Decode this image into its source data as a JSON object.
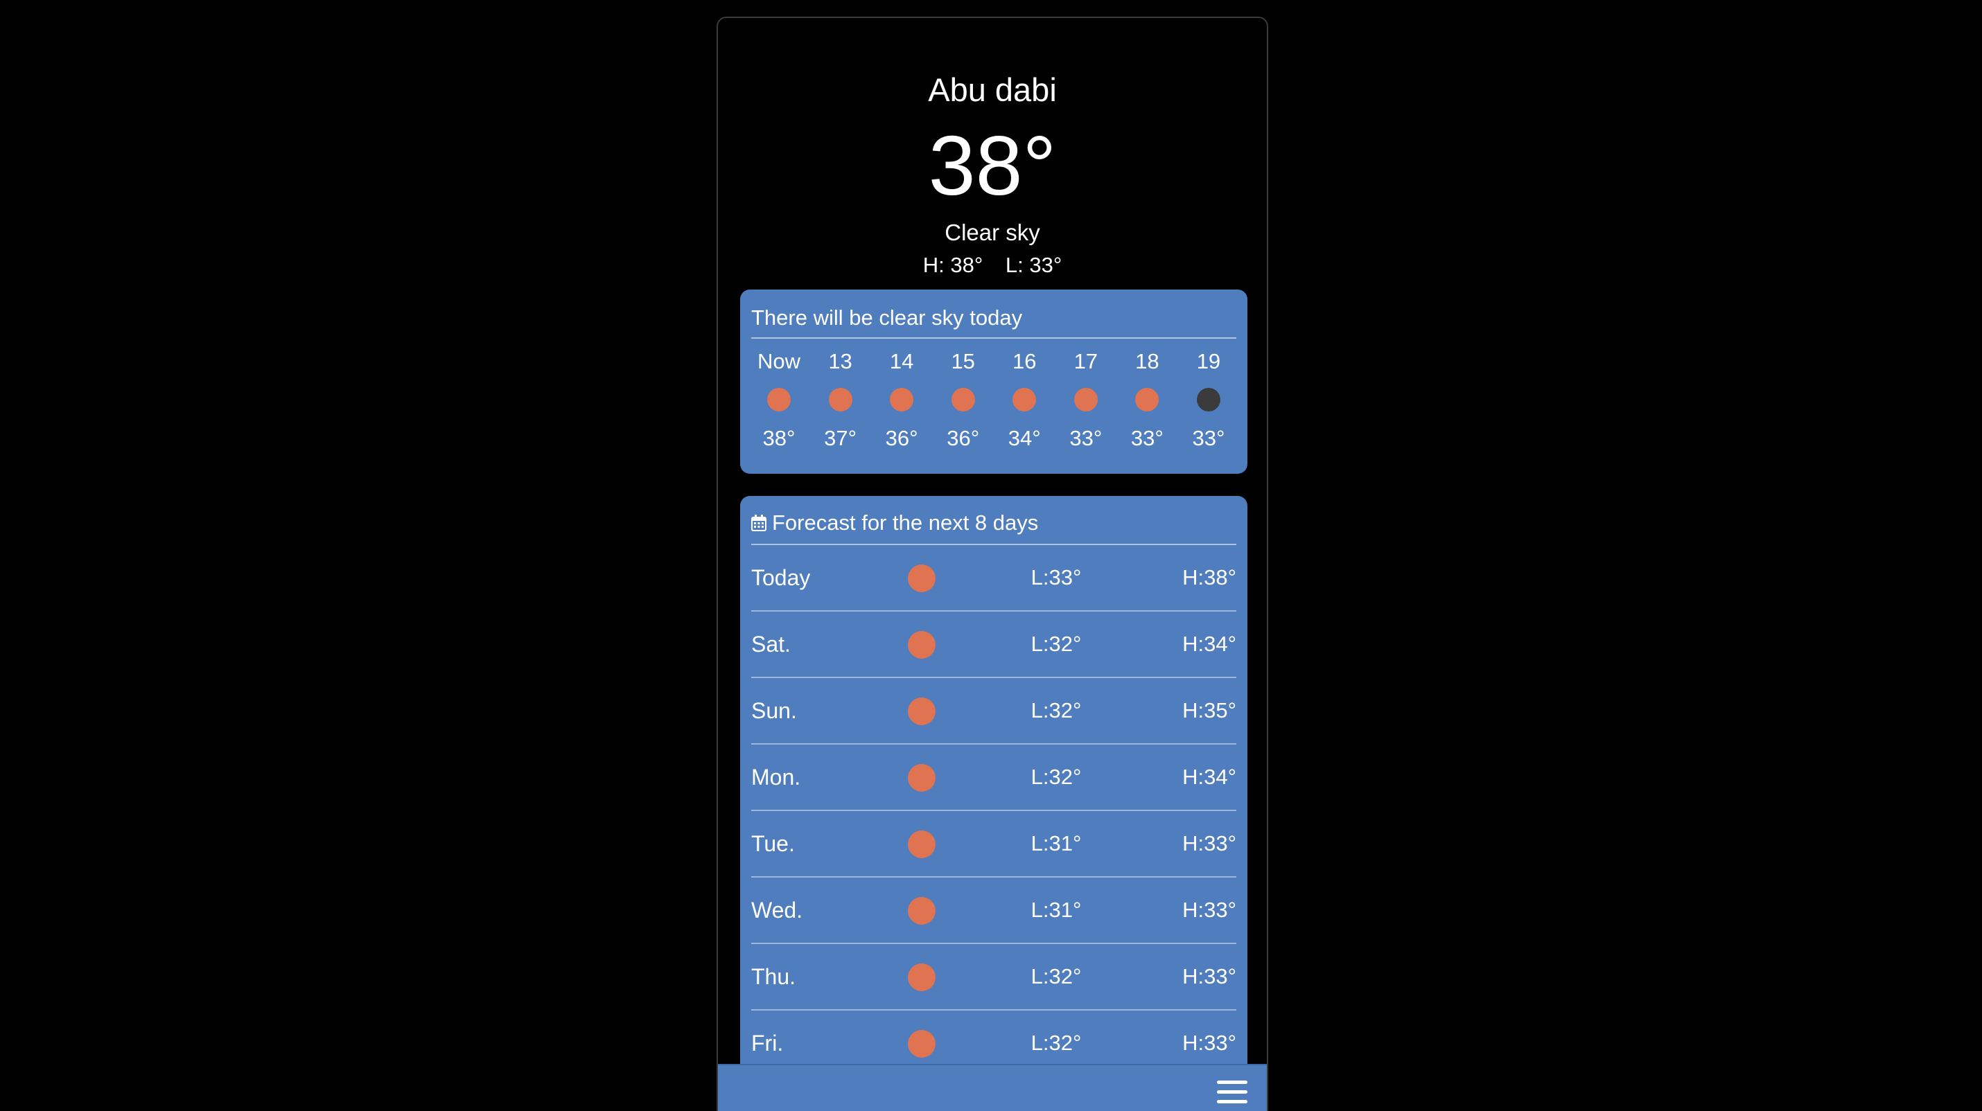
{
  "current": {
    "city": "Abu dabi",
    "temperature": "38°",
    "condition": "Clear sky",
    "high": "H: 38°",
    "low": "L: 33°"
  },
  "hourly": {
    "title": "There will be clear sky today",
    "items": [
      {
        "time": "Now",
        "temp": "38°",
        "icon": "sun-icon"
      },
      {
        "time": "13",
        "temp": "37°",
        "icon": "sun-icon"
      },
      {
        "time": "14",
        "temp": "36°",
        "icon": "sun-icon"
      },
      {
        "time": "15",
        "temp": "36°",
        "icon": "sun-icon"
      },
      {
        "time": "16",
        "temp": "34°",
        "icon": "sun-icon"
      },
      {
        "time": "17",
        "temp": "33°",
        "icon": "sun-icon"
      },
      {
        "time": "18",
        "temp": "33°",
        "icon": "sun-icon"
      },
      {
        "time": "19",
        "temp": "33°",
        "icon": "moon-icon"
      }
    ]
  },
  "daily": {
    "title": "Forecast for the next 8 days",
    "title_icon": "calendar-icon",
    "days": [
      {
        "day": "Today",
        "low": "L:33°",
        "high": "H:38°",
        "icon": "sun-icon"
      },
      {
        "day": "Sat.",
        "low": "L:32°",
        "high": "H:34°",
        "icon": "sun-icon"
      },
      {
        "day": "Sun.",
        "low": "L:32°",
        "high": "H:35°",
        "icon": "sun-icon"
      },
      {
        "day": "Mon.",
        "low": "L:32°",
        "high": "H:34°",
        "icon": "sun-icon"
      },
      {
        "day": "Tue.",
        "low": "L:31°",
        "high": "H:33°",
        "icon": "sun-icon"
      },
      {
        "day": "Wed.",
        "low": "L:31°",
        "high": "H:33°",
        "icon": "sun-icon"
      },
      {
        "day": "Thu.",
        "low": "L:32°",
        "high": "H:33°",
        "icon": "sun-icon"
      },
      {
        "day": "Fri.",
        "low": "L:32°",
        "high": "H:33°",
        "icon": "sun-icon"
      }
    ]
  },
  "bottom_bar": {
    "menu_icon": "hamburger-menu-icon"
  },
  "colors": {
    "background": "#000000",
    "card": "#4f7dbd",
    "sun": "#e07452",
    "moon": "#3b3b3b",
    "text": "#ffffff"
  }
}
